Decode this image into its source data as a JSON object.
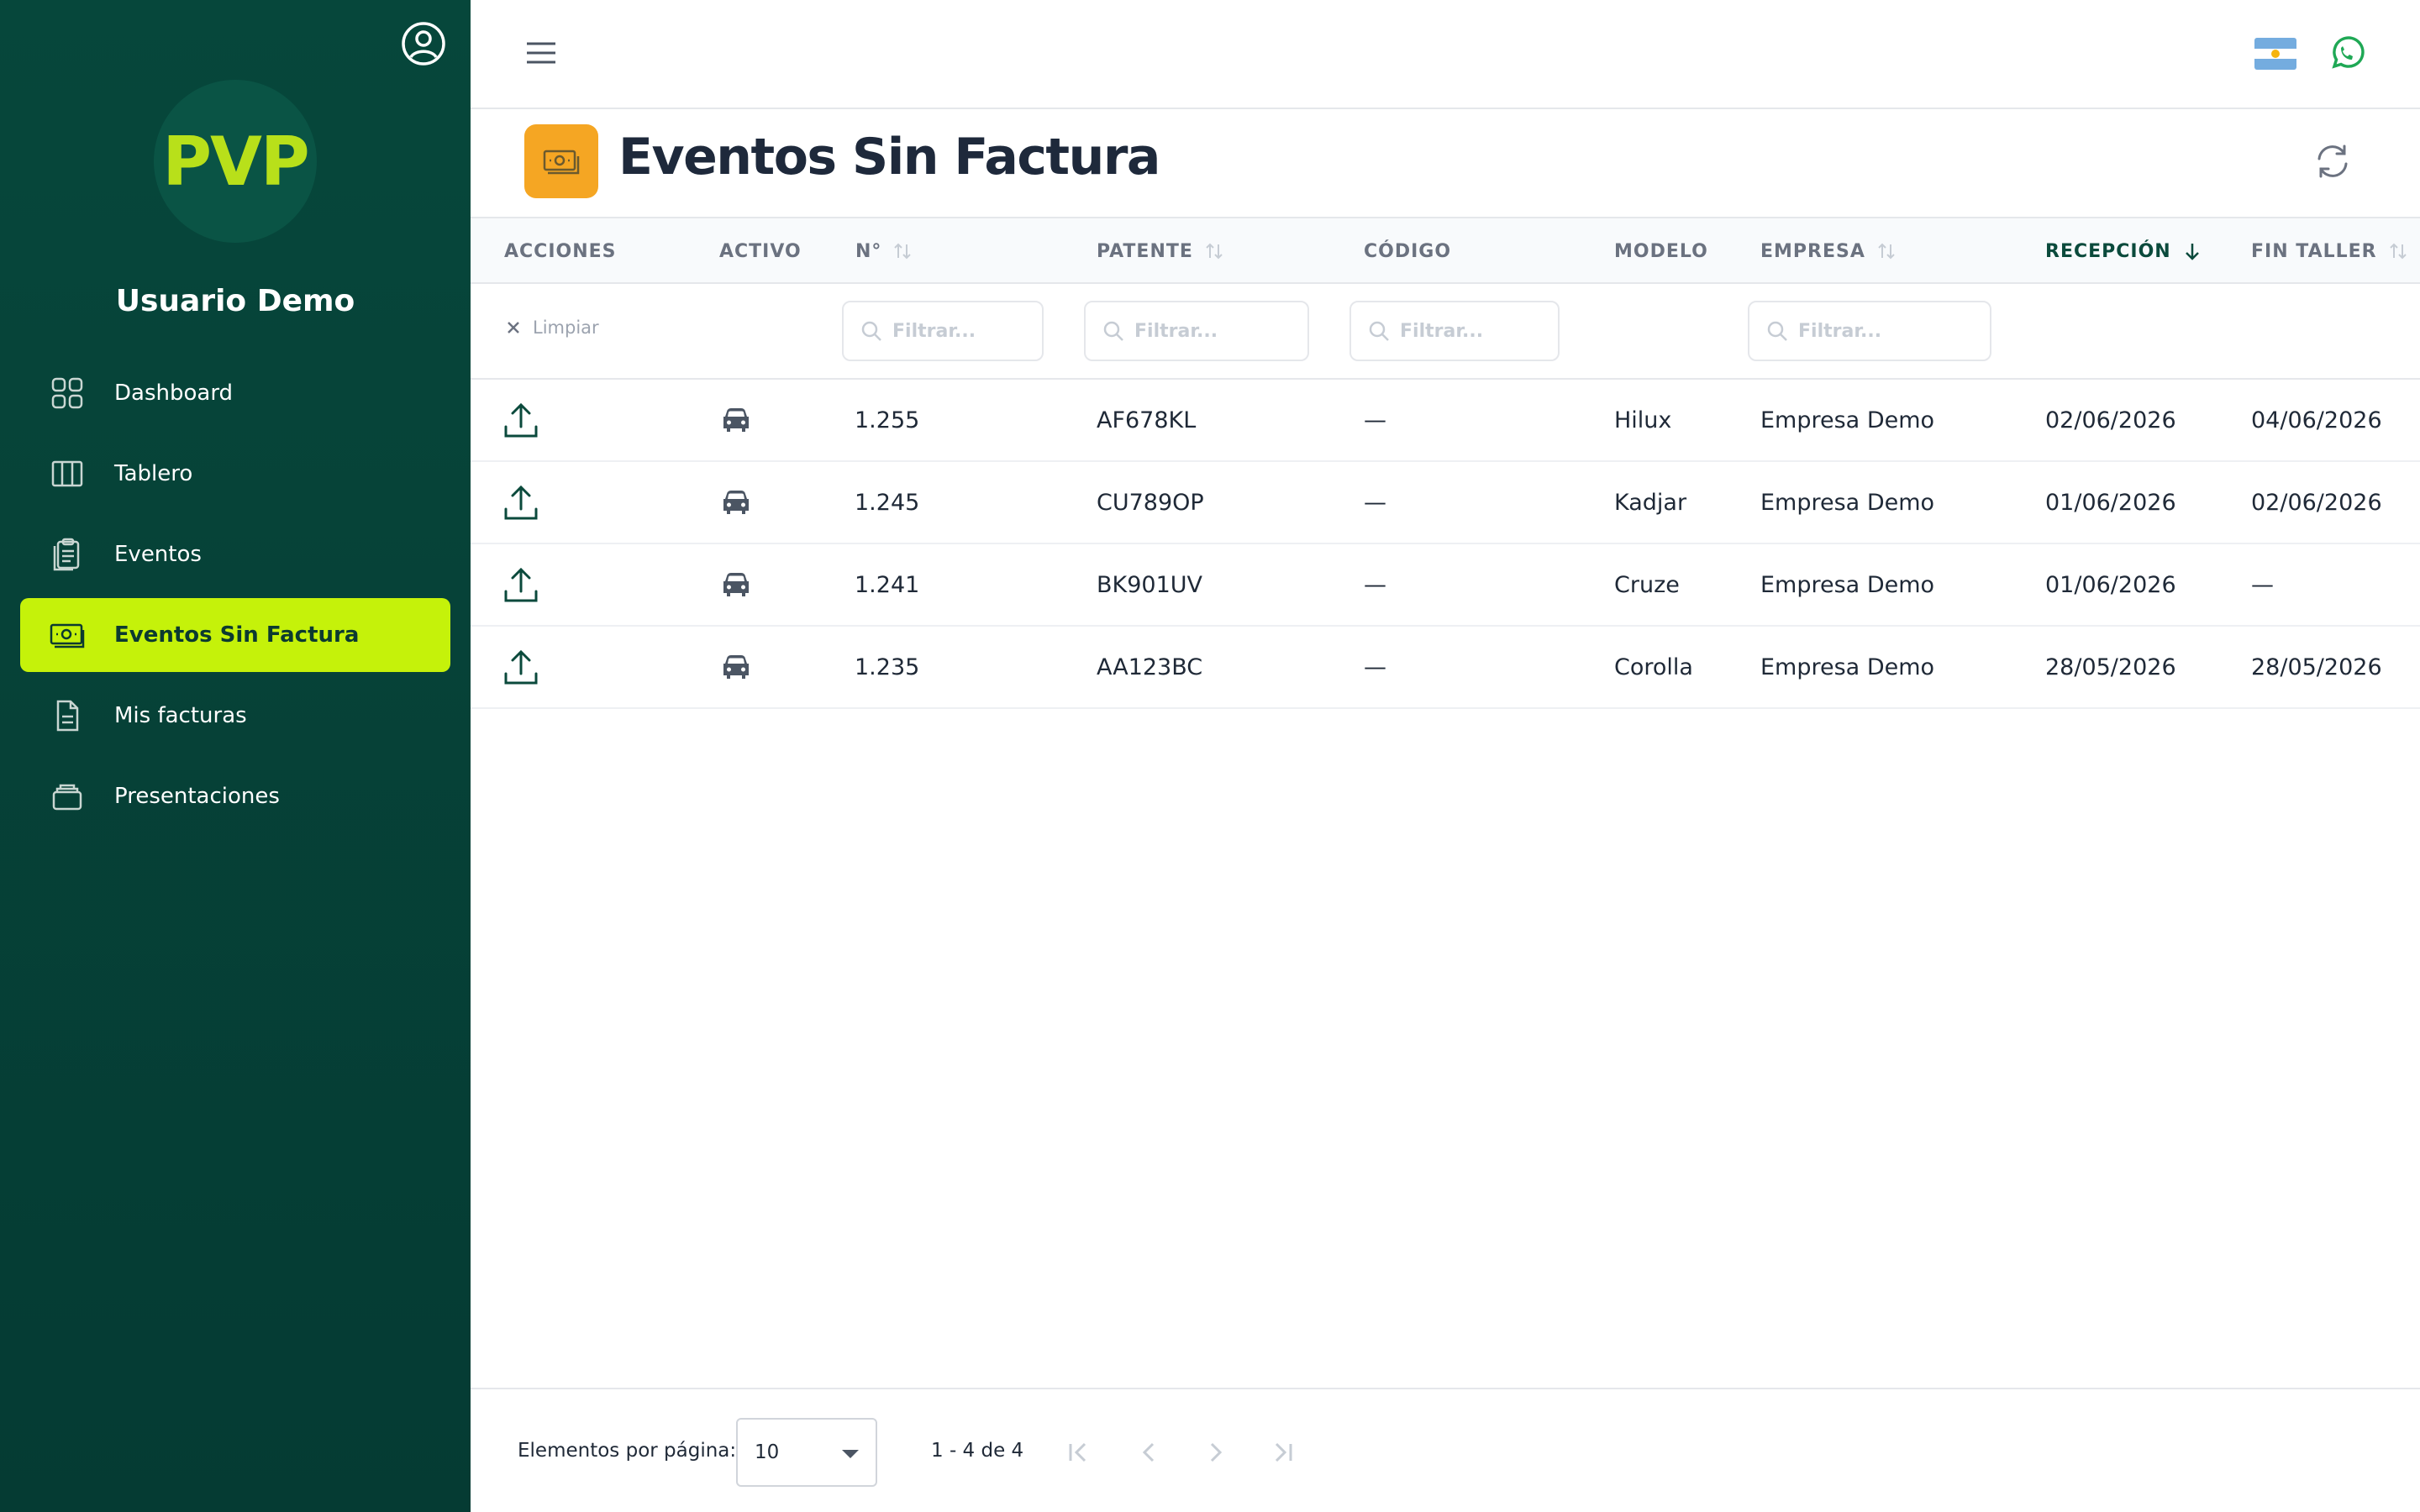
{
  "app": {
    "logo_text": "PVP",
    "accent": "#c5f20a",
    "sidebar_bg": "#06473b"
  },
  "sidebar": {
    "user_name": "Usuario Demo",
    "items": [
      {
        "label": "Dashboard",
        "icon": "grid-icon",
        "active": false
      },
      {
        "label": "Tablero",
        "icon": "columns-icon",
        "active": false
      },
      {
        "label": "Eventos",
        "icon": "clipboard-icon",
        "active": false
      },
      {
        "label": "Eventos Sin Factura",
        "icon": "cash-icon",
        "active": true
      },
      {
        "label": "Mis facturas",
        "icon": "document-icon",
        "active": false
      },
      {
        "label": "Presentaciones",
        "icon": "stack-icon",
        "active": false
      }
    ]
  },
  "topbar": {
    "flag": "argentina-flag-icon",
    "whatsapp": "whatsapp-icon"
  },
  "page": {
    "title": "Eventos Sin Factura",
    "title_icon_color": "#f5a623"
  },
  "table": {
    "columns": [
      {
        "label": "ACCIONES",
        "sortable": false
      },
      {
        "label": "ACTIVO",
        "sortable": false
      },
      {
        "label": "N°",
        "sortable": true
      },
      {
        "label": "PATENTE",
        "sortable": true
      },
      {
        "label": "CÓDIGO",
        "sortable": false
      },
      {
        "label": "MODELO",
        "sortable": false
      },
      {
        "label": "EMPRESA",
        "sortable": true
      },
      {
        "label": "RECEPCIÓN",
        "sortable": true,
        "sorted": "desc"
      },
      {
        "label": "FIN TALLER",
        "sortable": true
      }
    ],
    "clear_label": "Limpiar",
    "filter_placeholder": "Filtrar...",
    "rows": [
      {
        "numero": "1.255",
        "patente": "AF678KL",
        "codigo": "—",
        "modelo": "Hilux",
        "empresa": "Empresa Demo",
        "recepcion": "02/06/2026",
        "fin_taller": "04/06/2026"
      },
      {
        "numero": "1.245",
        "patente": "CU789OP",
        "codigo": "—",
        "modelo": "Kadjar",
        "empresa": "Empresa Demo",
        "recepcion": "01/06/2026",
        "fin_taller": "02/06/2026"
      },
      {
        "numero": "1.241",
        "patente": "BK901UV",
        "codigo": "—",
        "modelo": "Cruze",
        "empresa": "Empresa Demo",
        "recepcion": "01/06/2026",
        "fin_taller": "—"
      },
      {
        "numero": "1.235",
        "patente": "AA123BC",
        "codigo": "—",
        "modelo": "Corolla",
        "empresa": "Empresa Demo",
        "recepcion": "28/05/2026",
        "fin_taller": "28/05/2026"
      }
    ]
  },
  "paginator": {
    "per_page_label": "Elementos por página:",
    "per_page_value": "10",
    "range": "1 - 4 de 4"
  }
}
